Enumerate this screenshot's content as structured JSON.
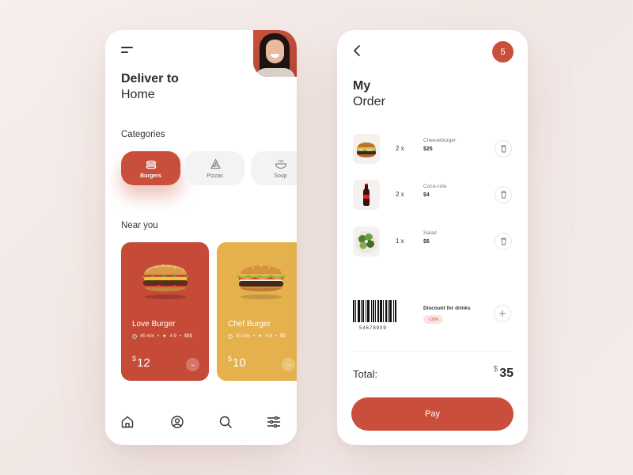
{
  "colors": {
    "accent": "#c94f3c",
    "card_red": "#c54a37",
    "card_yellow": "#e5b14c",
    "background": "#f4ecea"
  },
  "home": {
    "deliver_title": "Deliver to",
    "deliver_place": "Home",
    "categories_label": "Categories",
    "categories": [
      {
        "label": "Burgers",
        "icon": "burger-icon",
        "active": true
      },
      {
        "label": "Pizzas",
        "icon": "pizza-slice-icon",
        "active": false
      },
      {
        "label": "Soup",
        "icon": "soup-bowl-icon",
        "active": false
      }
    ],
    "near_label": "Near you",
    "restaurants": [
      {
        "name": "Love Burger",
        "time": "45 min",
        "rating": "4.9",
        "price_level": "$$$",
        "currency": "$",
        "price": "12",
        "arrow": "→"
      },
      {
        "name": "Chef Burger",
        "time": "30 min",
        "rating": "4.8",
        "price_level": "$$",
        "currency": "$",
        "price": "10",
        "arrow": "→"
      }
    ],
    "nav": [
      "home-icon",
      "profile-icon",
      "search-icon",
      "filter-icon"
    ]
  },
  "order": {
    "badge_count": "5",
    "title": "My",
    "subtitle": "Order",
    "items": [
      {
        "qty": "2 x",
        "name": "Cheeseburger",
        "price": "$25",
        "icon": "burger-photo"
      },
      {
        "qty": "2 x",
        "name": "Coca-cola",
        "price": "$4",
        "icon": "cola-bottle-photo"
      },
      {
        "qty": "1 x",
        "name": "Salad",
        "price": "$6",
        "icon": "salad-photo"
      }
    ],
    "barcode_number": "54678909",
    "discount_label": "Discount for drinks",
    "discount_value": "-10%",
    "total_label": "Total:",
    "total_currency": "$",
    "total_value": "35",
    "pay_label": "Pay"
  }
}
